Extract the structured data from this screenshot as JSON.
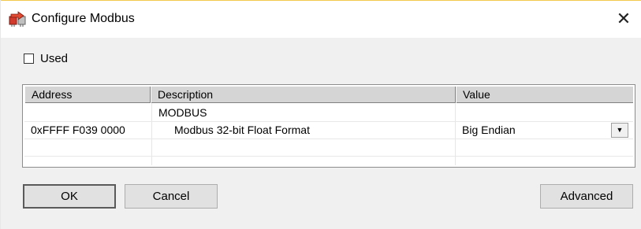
{
  "window": {
    "title": "Configure Modbus",
    "close_glyph": "✕"
  },
  "used_checkbox": {
    "label": "Used",
    "checked": false
  },
  "grid": {
    "columns": [
      "Address",
      "Description",
      "Value"
    ],
    "rows": [
      {
        "address": "",
        "description": "MODBUS",
        "value": ""
      },
      {
        "address": "0xFFFF F039 0000",
        "description": "Modbus 32-bit Float Format",
        "value": "Big Endian"
      },
      {
        "address": "",
        "description": "",
        "value": ""
      }
    ],
    "dropdown_glyph": "▼"
  },
  "buttons": {
    "ok": "OK",
    "cancel": "Cancel",
    "advanced": "Advanced"
  },
  "icons": {
    "app": "modbus-connector-icon",
    "close": "close-icon",
    "dropdown": "chevron-down-icon"
  }
}
